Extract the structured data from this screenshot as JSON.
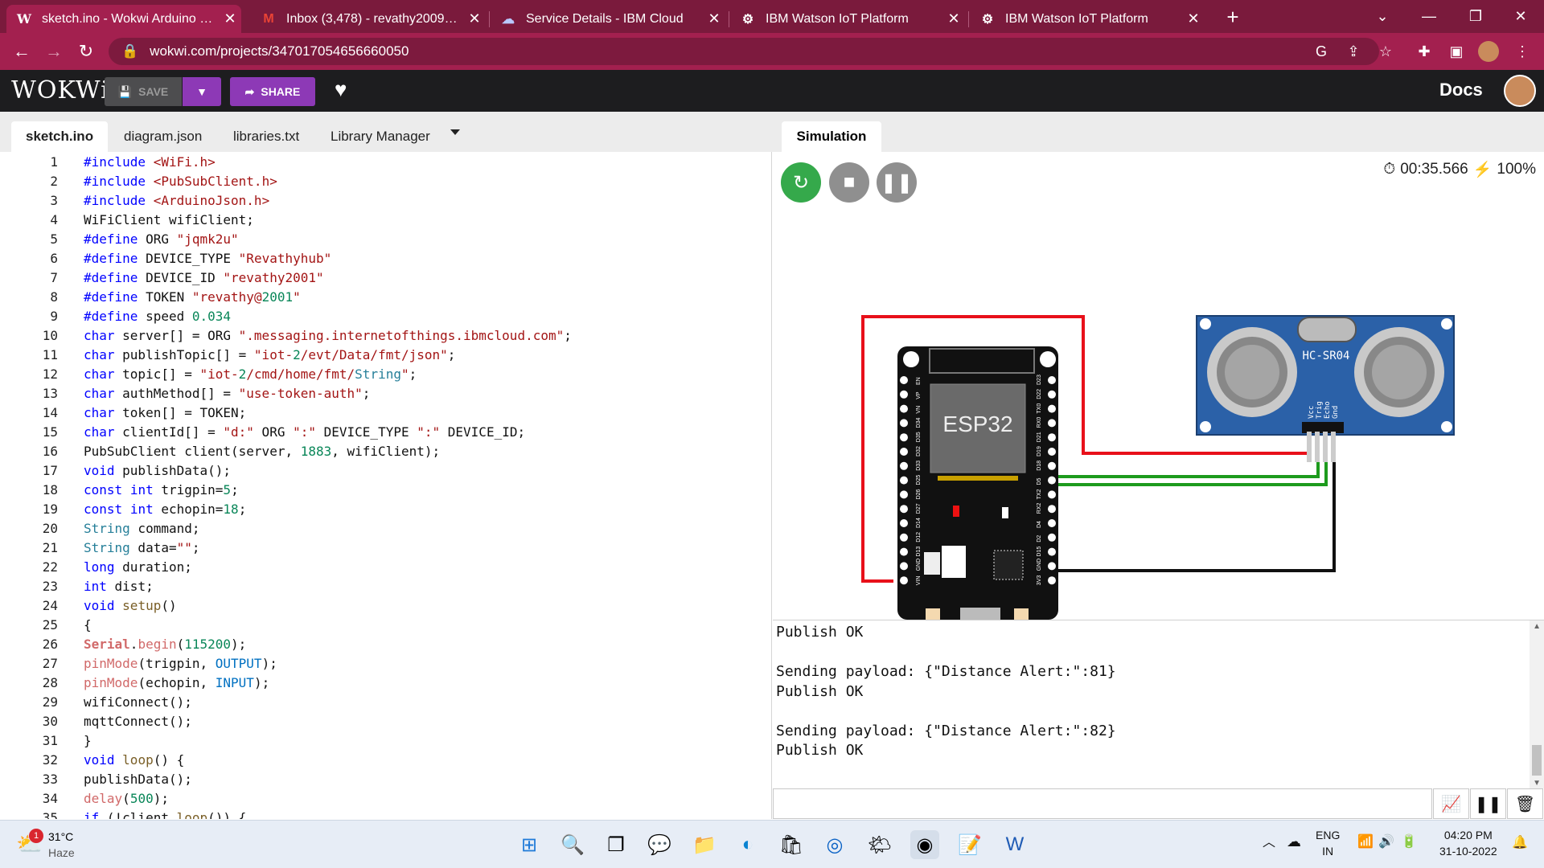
{
  "browser": {
    "tabs": [
      {
        "title": "sketch.ino - Wokwi Arduino and ESP32 Simulator",
        "favicon": "wokwi-w",
        "active": true
      },
      {
        "title": "Inbox (3,478) - revathy2009200107@gmail.com",
        "favicon": "gmail-m",
        "active": false
      },
      {
        "title": "Service Details - IBM Cloud",
        "favicon": "ibm-cloud-icon",
        "active": false
      },
      {
        "title": "IBM Watson IoT Platform",
        "favicon": "ibm-iot-icon",
        "active": false
      },
      {
        "title": "IBM Watson IoT Platform",
        "favicon": "ibm-iot-icon",
        "active": false
      }
    ],
    "url": "wokwi.com/projects/347017054656660050"
  },
  "wokwi": {
    "logo": "WOKWi",
    "save_label": "SAVE",
    "share_label": "SHARE",
    "docs_label": "Docs"
  },
  "editor": {
    "tabs": [
      "sketch.ino",
      "diagram.json",
      "libraries.txt",
      "Library Manager"
    ],
    "line_numbers": [
      "1",
      "2",
      "3",
      "4",
      "5",
      "6",
      "7",
      "8",
      "9",
      "10",
      "11",
      "12",
      "13",
      "14",
      "15",
      "16",
      "17",
      "18",
      "19",
      "20",
      "21",
      "22",
      "23",
      "24",
      "25",
      "26",
      "27",
      "28",
      "29",
      "30",
      "31",
      "32",
      "33",
      "34",
      "35"
    ],
    "lines": [
      "#include <WiFi.h>",
      "#include <PubSubClient.h>",
      "#include <ArduinoJson.h>",
      "WiFiClient wifiClient;",
      "#define ORG \"jqmk2u\"",
      "#define DEVICE_TYPE \"Revathyhub\"",
      "#define DEVICE_ID \"revathy2001\"",
      "#define TOKEN \"revathy@2001\"",
      "#define speed 0.034",
      "char server[] = ORG \".messaging.internetofthings.ibmcloud.com\";",
      "char publishTopic[] = \"iot-2/evt/Data/fmt/json\";",
      "char topic[] = \"iot-2/cmd/home/fmt/String\";",
      "char authMethod[] = \"use-token-auth\";",
      "char token[] = TOKEN;",
      "char clientId[] = \"d:\" ORG \":\" DEVICE_TYPE \":\" DEVICE_ID;",
      "PubSubClient client(server, 1883, wifiClient);",
      "void publishData();",
      "const int trigpin=5;",
      "const int echopin=18;",
      "String command;",
      "String data=\"\";",
      "long duration;",
      "int dist;",
      "void setup()",
      "{",
      "Serial.begin(115200);",
      "pinMode(trigpin, OUTPUT);",
      "pinMode(echopin, INPUT);",
      "wifiConnect();",
      "mqttConnect();",
      "}",
      "void loop() {",
      "publishData();",
      "delay(500);",
      "if (!client.loop()) {"
    ]
  },
  "simulation": {
    "tab_label": "Simulation",
    "timer": "00:35.566",
    "speed": "100%",
    "esp32_label": "ESP32",
    "sensor_label": "HC-SR04",
    "sensor_pins": [
      "Vcc",
      "Trig",
      "Echo",
      "Gnd"
    ],
    "esp_left_pins": [
      "EN",
      "VP",
      "VN",
      "D34",
      "D35",
      "D32",
      "D33",
      "D25",
      "D26",
      "D27",
      "D14",
      "D12",
      "D13",
      "GND",
      "VIN"
    ],
    "esp_right_pins": [
      "D23",
      "D22",
      "TX0",
      "RX0",
      "D21",
      "D19",
      "D18",
      "D5",
      "TX2",
      "RX2",
      "D4",
      "D2",
      "D15",
      "GND",
      "3V3"
    ],
    "wire_colors": {
      "vin": "#e8101a",
      "trig": "#1d9b1d",
      "echo": "#1d9b1d",
      "gnd": "#111111"
    }
  },
  "serial": {
    "lines": [
      "Publish OK",
      "",
      "Sending payload: {\"Distance Alert:\":81}",
      "Publish OK",
      "",
      "Sending payload: {\"Distance Alert:\":82}",
      "Publish OK"
    ]
  },
  "taskbar": {
    "weather_temp": "31°C",
    "weather_desc": "Haze",
    "weather_badge": "1",
    "lang_top": "ENG",
    "lang_bottom": "IN",
    "time": "04:20 PM",
    "date": "31-10-2022"
  }
}
